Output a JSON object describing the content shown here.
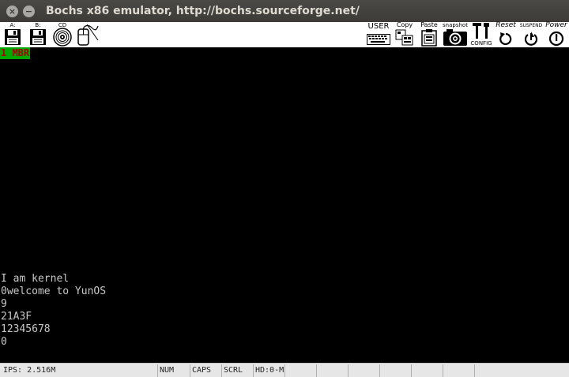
{
  "window": {
    "title": "Bochs x86 emulator, http://bochs.sourceforge.net/",
    "close_glyph": "×",
    "minimize_glyph": "−"
  },
  "toolbar": {
    "floppy_a": {
      "label": "A:",
      "icon": "floppy-disk-icon"
    },
    "floppy_b": {
      "label": "B:",
      "icon": "floppy-disk-icon"
    },
    "cdrom": {
      "label": "CD",
      "icon": "cdrom-icon"
    },
    "mouse": {
      "label": "",
      "icon": "mouse-icon"
    },
    "user": {
      "label": "USER",
      "icon": "keyboard-icon"
    },
    "copy": {
      "label": "Copy",
      "icon": "copy-icon"
    },
    "paste": {
      "label": "Paste",
      "icon": "clipboard-icon"
    },
    "snapshot": {
      "label": "snapshot",
      "icon": "camera-icon"
    },
    "config": {
      "label": "CONFIG",
      "icon": "config-tools-icon"
    },
    "reset": {
      "label": "Reset",
      "icon": "reset-icon"
    },
    "suspend": {
      "label": "SUSPEND",
      "icon": "suspend-icon"
    },
    "power": {
      "label": "Power",
      "icon": "power-icon"
    }
  },
  "screen": {
    "mbr_marker": "1 MBR",
    "lines": [
      "I am kernel",
      "0welcome to YunOS",
      "9",
      "21A3F",
      "12345678",
      "0"
    ],
    "colors": {
      "background": "#000000",
      "text": "#c8c8c8",
      "mbr_bg": "#00a800",
      "mbr_fg": "#a80000"
    }
  },
  "statusbar": {
    "ips": "IPS: 2.516M",
    "num": "NUM",
    "caps": "CAPS",
    "scrl": "SCRL",
    "hd": "HD:0-M"
  }
}
